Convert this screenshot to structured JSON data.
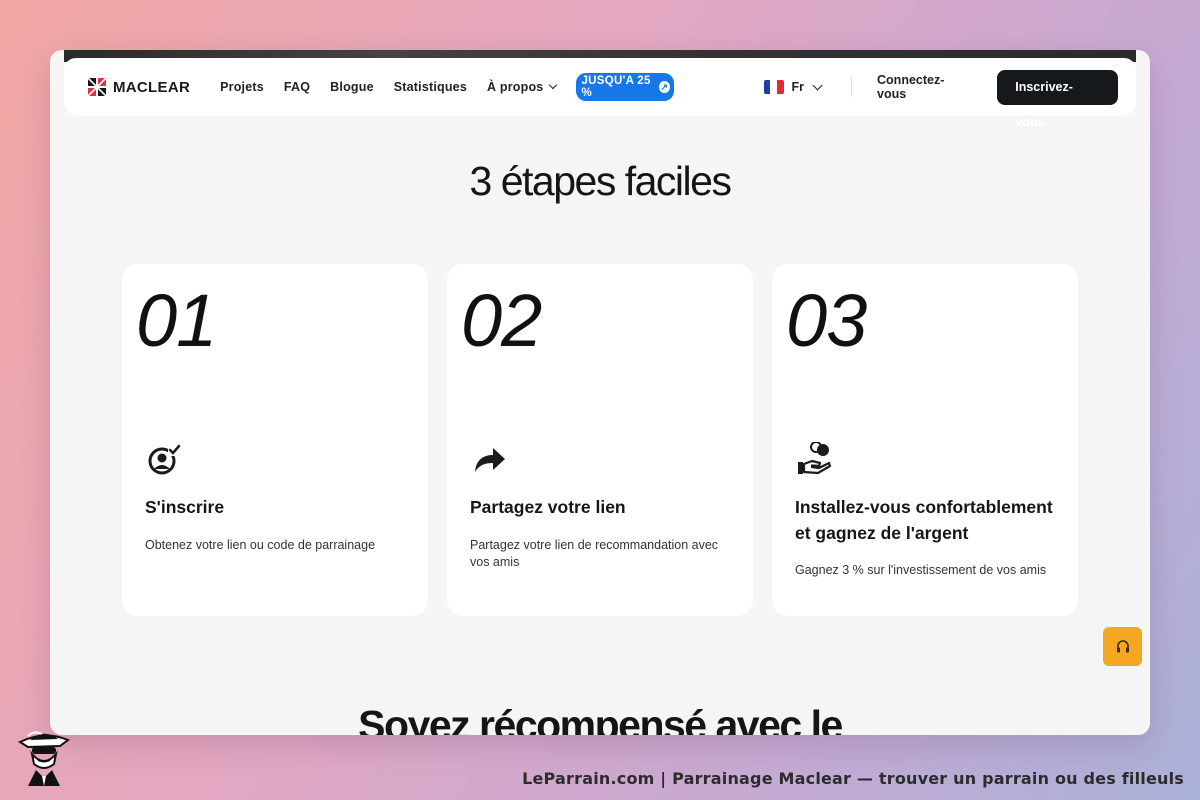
{
  "brand": {
    "name": "MACLEAR"
  },
  "nav": {
    "links": [
      "Projets",
      "FAQ",
      "Blogue",
      "Statistiques"
    ],
    "about_label": "À propos",
    "promo_label": "JUSQU'A 25 %",
    "language": "Fr",
    "login_label": "Connectez-vous",
    "signup_label": "Inscrivez-vous"
  },
  "section": {
    "title": "3 étapes faciles",
    "steps": [
      {
        "number": "01",
        "icon": "user-check-icon",
        "title": "S'inscrire",
        "description": "Obtenez votre lien ou code de parrainage"
      },
      {
        "number": "02",
        "icon": "share-arrow-icon",
        "title": "Partagez votre lien",
        "description": "Partagez votre lien de recommandation avec vos amis"
      },
      {
        "number": "03",
        "icon": "hand-coin-icon",
        "title": "Installez-vous confortablement et gagnez de l'argent",
        "description": "Gagnez 3 % sur l'investissement de vos amis"
      }
    ]
  },
  "next_section": {
    "title_partial": "Soyez récompensé avec le"
  },
  "support": {
    "icon": "headset-icon"
  },
  "footer": {
    "caption": "LeParrain.com | Parrainage Maclear — trouver un parrain ou des filleuls"
  },
  "colors": {
    "accent": "#1677e6",
    "dark": "#16191c",
    "support": "#f5a623"
  }
}
